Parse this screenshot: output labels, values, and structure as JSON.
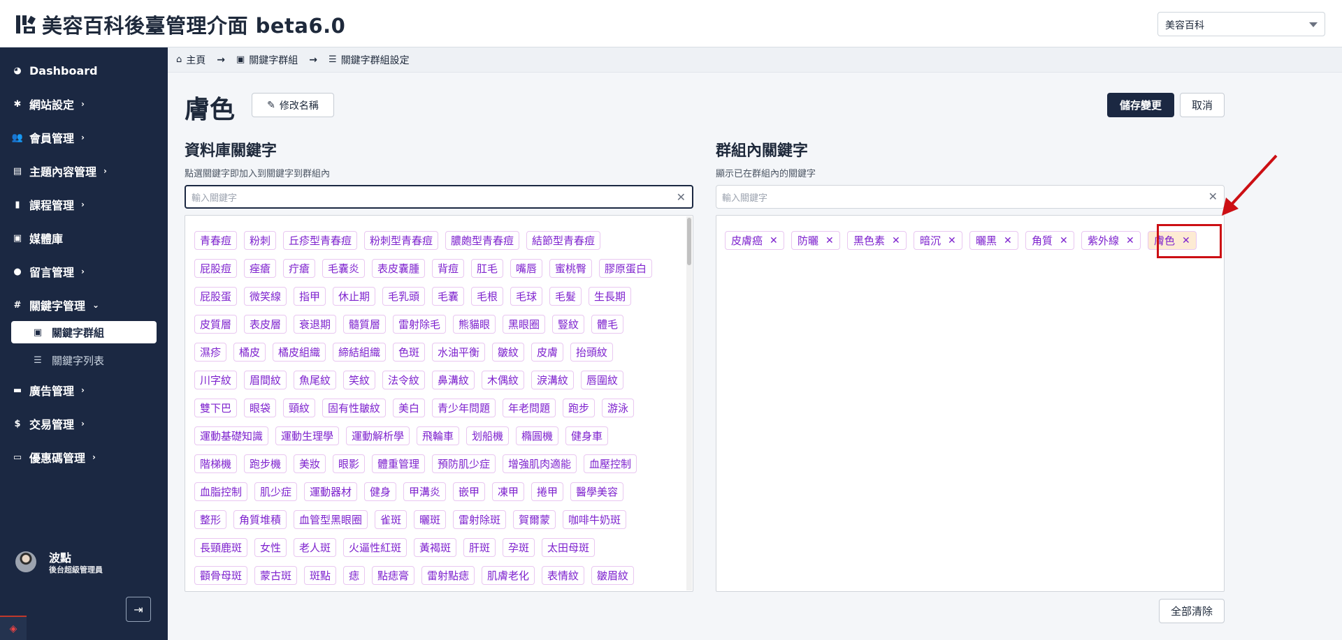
{
  "header": {
    "title": "美容百科後臺管理介面 beta6.0",
    "site_select": "美容百科"
  },
  "sidebar": {
    "items": [
      {
        "label": "Dashboard",
        "icon": "dashboard-icon",
        "chevron": ""
      },
      {
        "label": "網站設定",
        "icon": "gear-icon",
        "chevron": "›"
      },
      {
        "label": "會員管理",
        "icon": "users-icon",
        "chevron": "›"
      },
      {
        "label": "主題內容管理",
        "icon": "newspaper-icon",
        "chevron": "›"
      },
      {
        "label": "課程管理",
        "icon": "book-icon",
        "chevron": "›"
      },
      {
        "label": "媒體庫",
        "icon": "images-icon",
        "chevron": ""
      },
      {
        "label": "留言管理",
        "icon": "comment-icon",
        "chevron": "›"
      },
      {
        "label": "關鍵字管理",
        "icon": "hashtag-icon",
        "chevron": "⌄"
      },
      {
        "label": "廣告管理",
        "icon": "ad-icon",
        "chevron": "›"
      },
      {
        "label": "交易管理",
        "icon": "money-bag-icon",
        "chevron": "›"
      },
      {
        "label": "優惠碼管理",
        "icon": "ticket-icon",
        "chevron": "›"
      }
    ],
    "subitems": [
      {
        "label": "關鍵字群組",
        "icon": "group-icon"
      },
      {
        "label": "關鍵字列表",
        "icon": "list-icon"
      }
    ],
    "user": {
      "name": "波點",
      "role": "後台超級管理員"
    }
  },
  "breadcrumb": {
    "home": "主頁",
    "group": "關鍵字群組",
    "settings": "關鍵字群組設定"
  },
  "page": {
    "title": "膚色",
    "rename": "修改名稱",
    "save": "儲存變更",
    "cancel": "取消",
    "clear_all": "全部清除"
  },
  "db_keywords": {
    "title": "資料庫關鍵字",
    "desc": "點選關鍵字即加入到關鍵字到群組內",
    "placeholder": "輸入關鍵字",
    "rows": [
      [
        "青春痘",
        "粉刺",
        "丘疹型青春痘",
        "粉刺型青春痘",
        "膿皰型青春痘",
        "結節型青春痘"
      ],
      [
        "屁股痘",
        "痤瘡",
        "疔瘡",
        "毛囊炎",
        "表皮囊腫",
        "背痘",
        "肛毛",
        "嘴唇",
        "蜜桃臀",
        "膠原蛋白"
      ],
      [
        "屁股蛋",
        "微笑線",
        "指甲",
        "休止期",
        "毛乳頭",
        "毛囊",
        "毛根",
        "毛球",
        "毛髮",
        "生長期"
      ],
      [
        "皮質層",
        "表皮層",
        "衰退期",
        "髓質層",
        "雷射除毛",
        "熊貓眼",
        "黑眼圈",
        "豎紋",
        "體毛"
      ],
      [
        "濕疹",
        "橘皮",
        "橘皮組織",
        "締結組織",
        "色斑",
        "水油平衡",
        "皺紋",
        "皮膚",
        "抬頭紋"
      ],
      [
        "川字紋",
        "眉間紋",
        "魚尾紋",
        "笑紋",
        "法令紋",
        "鼻溝紋",
        "木偶紋",
        "淚溝紋",
        "唇圍紋"
      ],
      [
        "雙下巴",
        "眼袋",
        "頸紋",
        "固有性皺紋",
        "美白",
        "青少年問題",
        "年老問題",
        "跑步",
        "游泳"
      ],
      [
        "運動基礎知識",
        "運動生理學",
        "運動解析學",
        "飛輪車",
        "划船機",
        "橢圓機",
        "健身車"
      ],
      [
        "階梯機",
        "跑步機",
        "美妝",
        "眼影",
        "體重管理",
        "預防肌少症",
        "增強肌肉適能",
        "血壓控制"
      ],
      [
        "血脂控制",
        "肌少症",
        "運動器材",
        "健身",
        "甲溝炎",
        "嵌甲",
        "凍甲",
        "捲甲",
        "醫學美容"
      ],
      [
        "整形",
        "角質堆積",
        "血管型黑眼圈",
        "雀斑",
        "曬斑",
        "雷射除斑",
        "賀爾蒙",
        "咖啡牛奶斑"
      ],
      [
        "長頸鹿斑",
        "女性",
        "老人斑",
        "火逼性紅斑",
        "黃褐斑",
        "肝斑",
        "孕斑",
        "太田母斑"
      ],
      [
        "顴骨母斑",
        "蒙古斑",
        "斑點",
        "痣",
        "點痣膏",
        "雷射點痣",
        "肌膚老化",
        "表情紋",
        "皺眉紋"
      ]
    ]
  },
  "group_keywords": {
    "title": "群組內關鍵字",
    "desc": "顯示已在群組內的關鍵字",
    "placeholder": "輸入關鍵字",
    "items": [
      "皮膚癌",
      "防曬",
      "黑色素",
      "暗沉",
      "曬黑",
      "角質",
      "紫外線",
      "膚色"
    ]
  }
}
